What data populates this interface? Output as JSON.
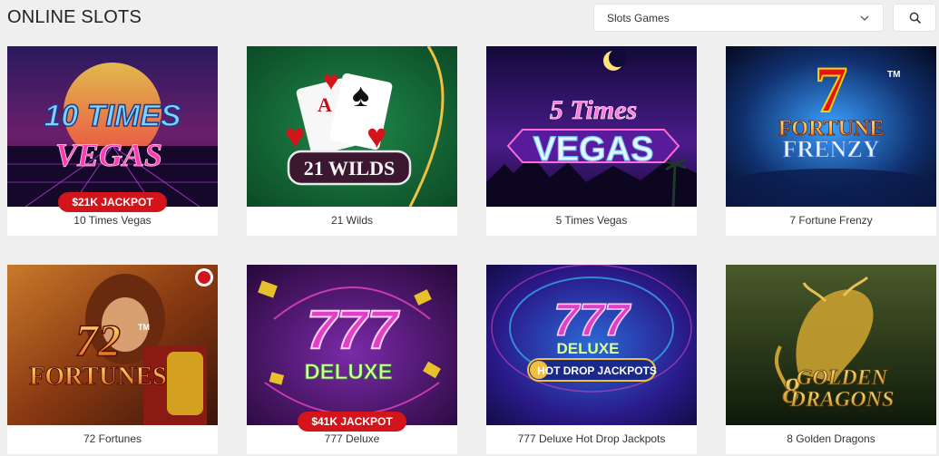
{
  "page": {
    "title": "ONLINE SLOTS"
  },
  "filter": {
    "selected": "Slots Games"
  },
  "games": [
    {
      "name": "10 Times Vegas",
      "art": [
        "10 TIMES",
        "VEGAS"
      ],
      "jackpot": "$21K JACKPOT"
    },
    {
      "name": "21 Wilds",
      "art": [
        "21 WILDS"
      ],
      "jackpot": ""
    },
    {
      "name": "5 Times Vegas",
      "art": [
        "5 Times",
        "VEGAS"
      ],
      "jackpot": ""
    },
    {
      "name": "7 Fortune Frenzy",
      "art": [
        "7",
        "FORTUNE",
        "FRENZY",
        "TM"
      ],
      "jackpot": ""
    },
    {
      "name": "72 Fortunes",
      "art": [
        "72",
        "FORTUNES",
        "TM"
      ],
      "jackpot": ""
    },
    {
      "name": "777 Deluxe",
      "art": [
        "777",
        "DELUXE"
      ],
      "jackpot": "$41K JACKPOT"
    },
    {
      "name": "777 Deluxe Hot Drop Jackpots",
      "art": [
        "777",
        "DELUXE",
        "HOT DROP JACKPOTS"
      ],
      "jackpot": ""
    },
    {
      "name": "8 Golden Dragons",
      "art": [
        "8",
        "GOLDEN",
        "DRAGONS"
      ],
      "jackpot": ""
    }
  ]
}
